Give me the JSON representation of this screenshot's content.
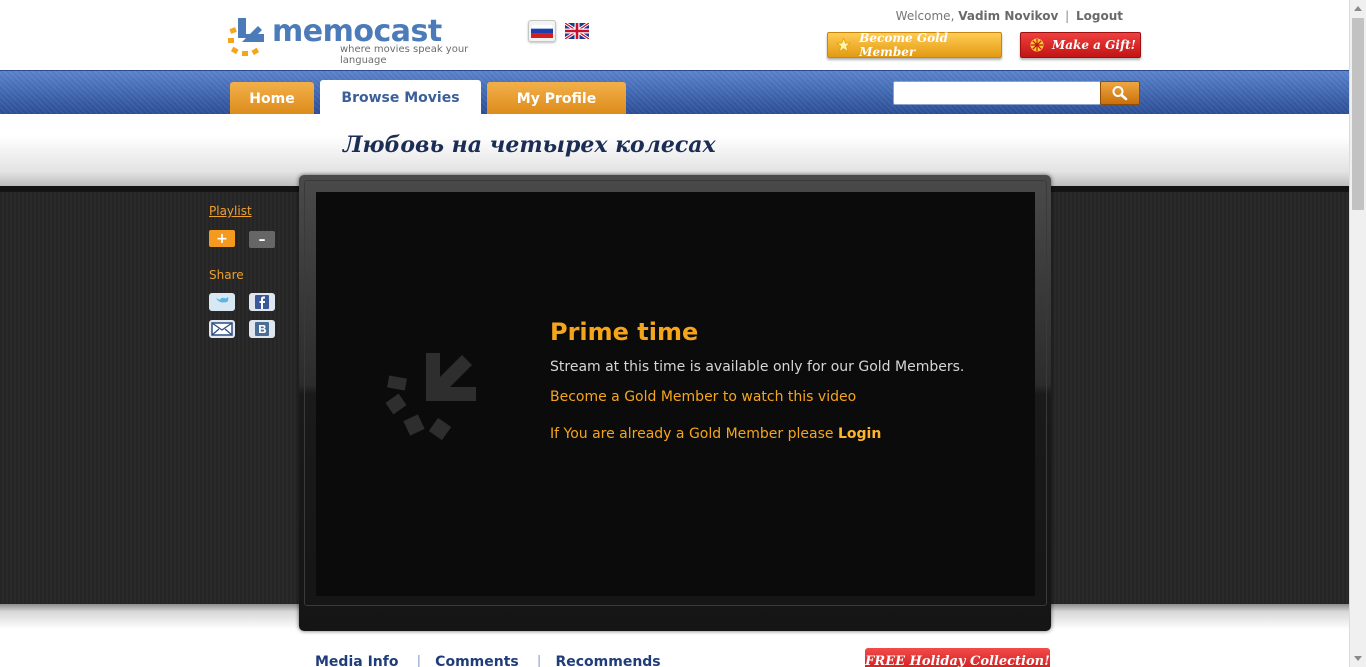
{
  "brand": {
    "name_part1": "memo",
    "name_part2": "cast",
    "tagline": "where movies speak your language",
    "logo_icon": "memocast-arrow-icon"
  },
  "languages": [
    {
      "name": "Russian",
      "icon": "russia-flag-icon"
    },
    {
      "name": "English",
      "icon": "uk-flag-icon"
    }
  ],
  "user": {
    "welcome_prefix": "Welcome,",
    "name": "Vadim Novikov",
    "separator": "|",
    "logout_label": "Logout"
  },
  "header_buttons": {
    "gold_label": "Become Gold Member",
    "gold_icon": "star-icon",
    "gift_label": "Make a Gift!",
    "gift_icon": "snowflake-icon"
  },
  "nav": {
    "tabs": [
      {
        "label": "Home",
        "active": false
      },
      {
        "label": "Browse Movies",
        "active": true
      },
      {
        "label": "My Profile",
        "active": false
      }
    ],
    "search": {
      "value": "",
      "placeholder": "",
      "icon": "magnifier-icon"
    }
  },
  "movie": {
    "title": "Любовь на четырех колесах"
  },
  "sidebar": {
    "playlist_label": "Playlist",
    "add_label": "+",
    "remove_label": "–",
    "share_label": "Share",
    "share_icons": [
      "twitter-icon",
      "facebook-icon",
      "email-icon",
      "vkontakte-icon"
    ]
  },
  "player": {
    "heading": "Prime time",
    "message": "Stream at this time is available only for our Gold Members.",
    "become_link": "Become a Gold Member to watch this video",
    "login_prefix": "If You are already a Gold Member please",
    "login_label": "Login"
  },
  "bottom_tabs": [
    "Media Info",
    "Comments",
    "Recommends"
  ],
  "promo": {
    "label": "FREE Holiday Collection!"
  },
  "colors": {
    "accent_orange": "#f5a51c",
    "nav_blue": "#2b4e97",
    "title_navy": "#1c2d55",
    "gift_red": "#c81616"
  }
}
